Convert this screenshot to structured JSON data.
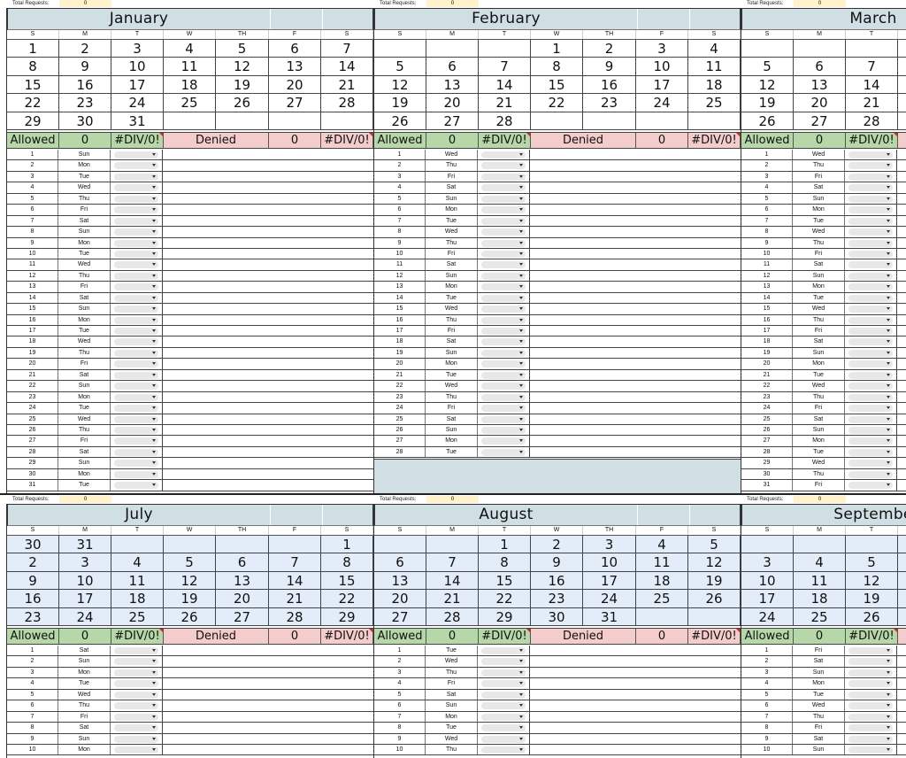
{
  "total_requests": {
    "label": "Total Requests:",
    "value": "0"
  },
  "dow": [
    "S",
    "M",
    "T",
    "W",
    "TH",
    "F",
    "S"
  ],
  "stats": {
    "allowed_label": "Allowed",
    "allowed_value": "0",
    "allowed_pct": "#DIV/0!",
    "denied_label": "Denied",
    "denied_value": "0",
    "denied_pct": "#DIV/0!"
  },
  "sections": [
    {
      "months": [
        {
          "name": "January",
          "weeks": [
            [
              "1",
              "2",
              "3",
              "4",
              "5",
              "6",
              "7"
            ],
            [
              "8",
              "9",
              "10",
              "11",
              "12",
              "13",
              "14"
            ],
            [
              "15",
              "16",
              "17",
              "18",
              "19",
              "20",
              "21"
            ],
            [
              "22",
              "23",
              "24",
              "25",
              "26",
              "27",
              "28"
            ],
            [
              "29",
              "30",
              "31",
              "",
              "",
              "",
              ""
            ]
          ],
          "days": [
            "Sun",
            "Mon",
            "Tue",
            "Wed",
            "Thu",
            "Fri",
            "Sat",
            "Sun",
            "Mon",
            "Tue",
            "Wed",
            "Thu",
            "Fri",
            "Sat",
            "Sun",
            "Mon",
            "Tue",
            "Wed",
            "Thu",
            "Fri",
            "Sat",
            "Sun",
            "Mon",
            "Tue",
            "Wed",
            "Thu",
            "Fri",
            "Sat",
            "Sun",
            "Mon",
            "Tue"
          ]
        },
        {
          "name": "February",
          "weeks": [
            [
              "",
              "",
              "",
              "1",
              "2",
              "3",
              "4"
            ],
            [
              "5",
              "6",
              "7",
              "8",
              "9",
              "10",
              "11"
            ],
            [
              "12",
              "13",
              "14",
              "15",
              "16",
              "17",
              "18"
            ],
            [
              "19",
              "20",
              "21",
              "22",
              "23",
              "24",
              "25"
            ],
            [
              "26",
              "27",
              "28",
              "",
              "",
              "",
              ""
            ]
          ],
          "days": [
            "Wed",
            "Thu",
            "Fri",
            "Sat",
            "Sun",
            "Mon",
            "Tue",
            "Wed",
            "Thu",
            "Fri",
            "Sat",
            "Sun",
            "Mon",
            "Tue",
            "Wed",
            "Thu",
            "Fri",
            "Sat",
            "Sun",
            "Mon",
            "Tue",
            "Wed",
            "Thu",
            "Fri",
            "Sat",
            "Sun",
            "Mon",
            "Tue"
          ]
        },
        {
          "name": "March",
          "weeks": [
            [
              "",
              "",
              "",
              "",
              "",
              "",
              ""
            ],
            [
              "5",
              "6",
              "7",
              "",
              "",
              "",
              ""
            ],
            [
              "12",
              "13",
              "14",
              "",
              "",
              "",
              ""
            ],
            [
              "19",
              "20",
              "21",
              "",
              "",
              "",
              ""
            ],
            [
              "26",
              "27",
              "28",
              "",
              "",
              "",
              ""
            ]
          ],
          "days": [
            "Wed",
            "Thu",
            "Fri",
            "Sat",
            "Sun",
            "Mon",
            "Tue",
            "Wed",
            "Thu",
            "Fri",
            "Sat",
            "Sun",
            "Mon",
            "Tue",
            "Wed",
            "Thu",
            "Fri",
            "Sat",
            "Sun",
            "Mon",
            "Tue",
            "Wed",
            "Thu",
            "Fri",
            "Sat",
            "Sun",
            "Mon",
            "Tue",
            "Wed",
            "Thu",
            "Fri"
          ]
        }
      ]
    },
    {
      "months": [
        {
          "name": "July",
          "weeks": [
            [
              "30",
              "31",
              "",
              "",
              "",
              "",
              "1"
            ],
            [
              "2",
              "3",
              "4",
              "5",
              "6",
              "7",
              "8"
            ],
            [
              "9",
              "10",
              "11",
              "12",
              "13",
              "14",
              "15"
            ],
            [
              "16",
              "17",
              "18",
              "19",
              "20",
              "21",
              "22"
            ],
            [
              "23",
              "24",
              "25",
              "26",
              "27",
              "28",
              "29"
            ]
          ],
          "days": [
            "Sat",
            "Sun",
            "Mon",
            "Tue",
            "Wed",
            "Thu",
            "Fri",
            "Sat",
            "Sun",
            "Mon"
          ]
        },
        {
          "name": "August",
          "weeks": [
            [
              "",
              "",
              "1",
              "2",
              "3",
              "4",
              "5"
            ],
            [
              "6",
              "7",
              "8",
              "9",
              "10",
              "11",
              "12"
            ],
            [
              "13",
              "14",
              "15",
              "16",
              "17",
              "18",
              "19"
            ],
            [
              "20",
              "21",
              "22",
              "23",
              "24",
              "25",
              "26"
            ],
            [
              "27",
              "28",
              "29",
              "30",
              "31",
              "",
              ""
            ]
          ],
          "days": [
            "Tue",
            "Wed",
            "Thu",
            "Fri",
            "Sat",
            "Sun",
            "Mon",
            "Tue",
            "Wed",
            "Thu"
          ]
        },
        {
          "name": "Septembe",
          "weeks": [
            [
              "",
              "",
              "",
              "",
              "",
              "",
              ""
            ],
            [
              "3",
              "4",
              "5",
              "",
              "",
              "",
              ""
            ],
            [
              "10",
              "11",
              "12",
              "",
              "",
              "",
              ""
            ],
            [
              "17",
              "18",
              "19",
              "",
              "",
              "",
              ""
            ],
            [
              "24",
              "25",
              "26",
              "",
              "",
              "",
              ""
            ]
          ],
          "days": [
            "Fri",
            "Sat",
            "Sun",
            "Mon",
            "Tue",
            "Wed",
            "Thu",
            "Fri",
            "Sat",
            "Sun"
          ]
        }
      ]
    }
  ]
}
